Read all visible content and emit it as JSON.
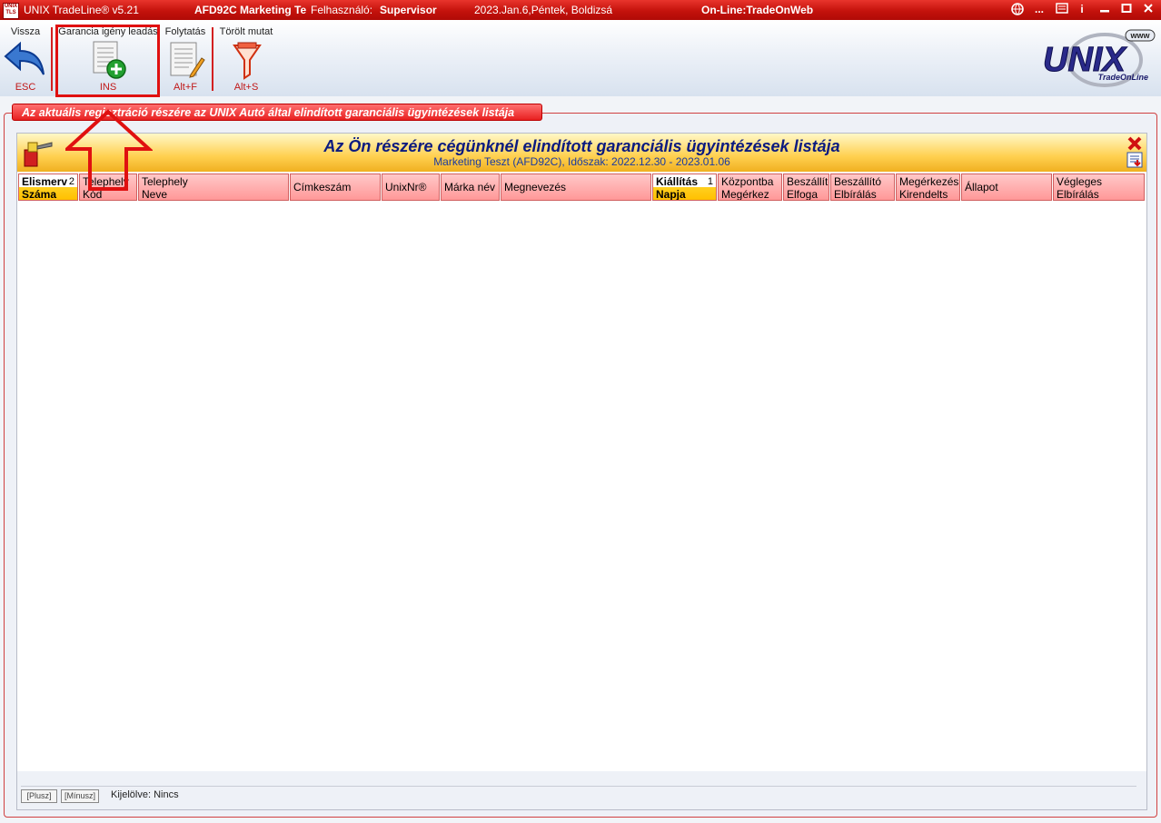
{
  "titlebar": {
    "app_title": "UNIX TradeLine® v5.21",
    "company": "AFD92C Marketing Te",
    "user_label": "Felhasználó:",
    "user_name": "Supervisor",
    "date": "2023.Jan.6,Péntek, Boldizsá",
    "online": "On-Line:TradeOnWeb"
  },
  "toolbar": {
    "back": {
      "label": "Vissza",
      "key": "ESC"
    },
    "add": {
      "label": "Garancia igény leadás",
      "key": "INS"
    },
    "continue": {
      "label": "Folytatás",
      "key": "Alt+F"
    },
    "deleted": {
      "label": "Törölt mutat",
      "key": "Alt+S"
    }
  },
  "logo": {
    "www": "www",
    "brand": "UNIX",
    "tagline": "TradeOnLine"
  },
  "notice": "Az aktuális regisztráció részére az UNIX Autó által elindított garanciális ügyintézések listája",
  "panel": {
    "title": "Az Ön részére cégünknél elindított garanciális ügyintézések listája",
    "subtitle": "Marketing Teszt (AFD92C), Időszak: 2022.12.30 - 2023.01.06"
  },
  "columns": [
    {
      "l1": "Elismerv",
      "l2": "Száma",
      "sort": "2"
    },
    {
      "l1": "Telephely",
      "l2": "Kód"
    },
    {
      "l1": "Telephely",
      "l2": "Neve"
    },
    {
      "l1": "Címkeszám",
      "l2": ""
    },
    {
      "l1": "UnixNr®",
      "l2": ""
    },
    {
      "l1": "Márka név",
      "l2": ""
    },
    {
      "l1": "Megnevezés",
      "l2": ""
    },
    {
      "l1": "Kiállítás",
      "l2": "Napja",
      "sort": "1"
    },
    {
      "l1": "Központba",
      "l2": "Megérkez"
    },
    {
      "l1": "Beszállító",
      "l2": "Elfoga"
    },
    {
      "l1": "Beszállító",
      "l2": "Elbírálás"
    },
    {
      "l1": "Megérkezés",
      "l2": "Kirendelts"
    },
    {
      "l1": "Állapot",
      "l2": ""
    },
    {
      "l1": "Végleges",
      "l2": "Elbírálás"
    }
  ],
  "footer": {
    "plus": "[Plusz]",
    "minus": "[Mínusz]",
    "selected": "Kijelölve:  Nincs"
  },
  "colors": {
    "accent": "#e01010",
    "header_gold": "#ffd050",
    "column_pink": "#ff9898",
    "title_blue": "#0a1a80"
  }
}
